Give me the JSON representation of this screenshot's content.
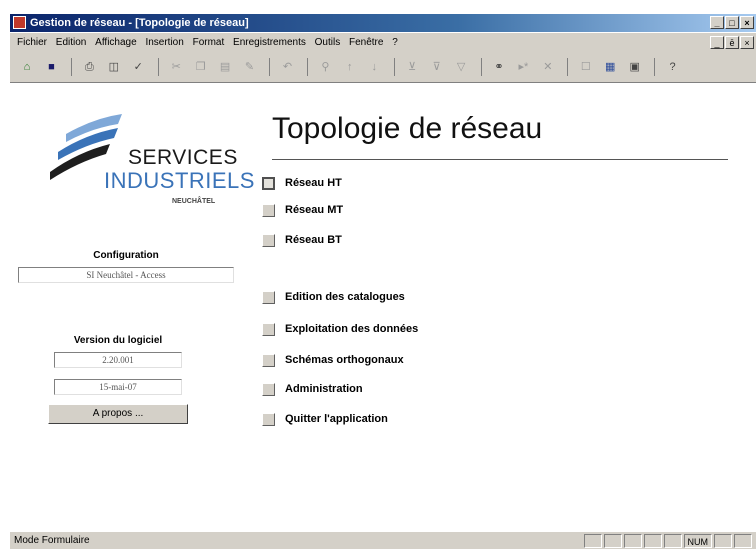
{
  "window": {
    "title": "Gestion de réseau - [Topologie de réseau]",
    "controls": [
      "_",
      "□",
      "×"
    ]
  },
  "menubar": {
    "items": [
      "Fichier",
      "Edition",
      "Affichage",
      "Insertion",
      "Format",
      "Enregistrements",
      "Outils",
      "Fenêtre",
      "?"
    ],
    "doc_controls": [
      "_",
      "ē",
      "×"
    ]
  },
  "toolbar": {
    "icons": [
      "design-view-icon",
      "save-icon",
      "print-icon",
      "print-preview-icon",
      "spelling-icon",
      "cut-icon",
      "copy-icon",
      "paste-icon",
      "format-painter-icon",
      "undo-icon",
      "insert-hyperlink-icon",
      "sort-ascending-icon",
      "sort-descending-icon",
      "filter-by-selection-icon",
      "filter-by-form-icon",
      "apply-filter-icon",
      "find-icon",
      "new-record-icon",
      "delete-record-icon",
      "properties-icon",
      "database-window-icon",
      "new-object-icon",
      "help-icon"
    ]
  },
  "logo": {
    "line1": "SERVICES",
    "line2": "INDUSTRIELS",
    "line3": "NEUCHÂTEL"
  },
  "configuration": {
    "label": "Configuration",
    "value": "SI Neuchâtel - Access"
  },
  "version": {
    "label": "Version du logiciel",
    "number": "2.20.001",
    "date": "15-mai-07"
  },
  "about_button": "A propos ...",
  "main": {
    "heading": "Topologie de réseau",
    "options": [
      {
        "label": "Réseau HT"
      },
      {
        "label": "Réseau MT"
      },
      {
        "label": "Réseau BT"
      },
      {
        "label": "Edition des catalogues"
      },
      {
        "label": "Exploitation des données"
      },
      {
        "label": "Schémas orthogonaux"
      },
      {
        "label": "Administration"
      },
      {
        "label": "Quitter l'application"
      }
    ]
  },
  "statusbar": {
    "mode": "Mode Formulaire",
    "num": "NUM"
  },
  "colors": {
    "titlebar_start": "#0a246a",
    "chrome": "#d4d0c8",
    "logo_blue": "#3a73b8"
  }
}
